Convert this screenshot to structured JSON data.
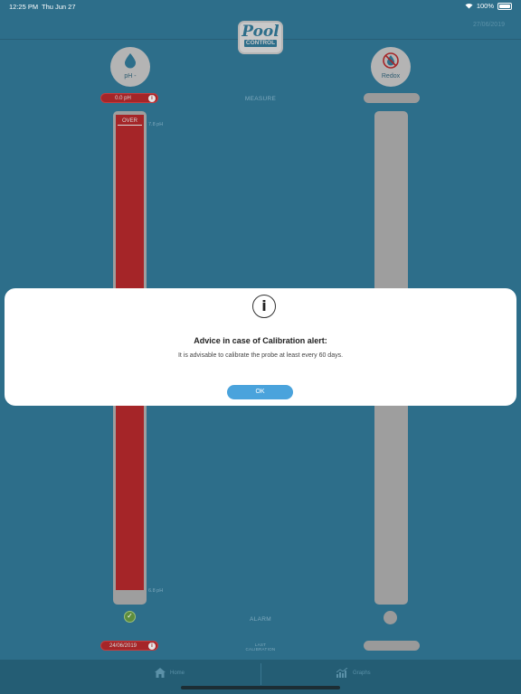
{
  "status_bar": {
    "time": "12:25 PM",
    "date": "Thu Jun 27",
    "battery": "100%"
  },
  "header": {
    "logo_line1": "Pool",
    "logo_line2": "CONTROL",
    "date": "27/06/2019"
  },
  "sensors": {
    "ph": {
      "label": "pH -",
      "measure_value": "0.0 pH",
      "gauge_status": "OVER",
      "top_tick": "7.8 pH",
      "bottom_tick": "6.8 pH",
      "calibration_date": "24/06/2019"
    },
    "redox": {
      "label": "Redox"
    }
  },
  "center_labels": {
    "measure": "MEASURE",
    "alarm": "ALARM",
    "last_calibration_line1": "LAST",
    "last_calibration_line2": "CALIBRATION"
  },
  "tabs": {
    "home": "Home",
    "graphs": "Graphs"
  },
  "modal": {
    "title": "Advice in case of Calibration alert:",
    "body": "It is advisable to calibrate the probe at least every 60 days.",
    "ok_label": "OK"
  },
  "colors": {
    "background": "#2d6e8a",
    "alert_red": "#a52528",
    "ok_blue": "#4aa3dc"
  }
}
